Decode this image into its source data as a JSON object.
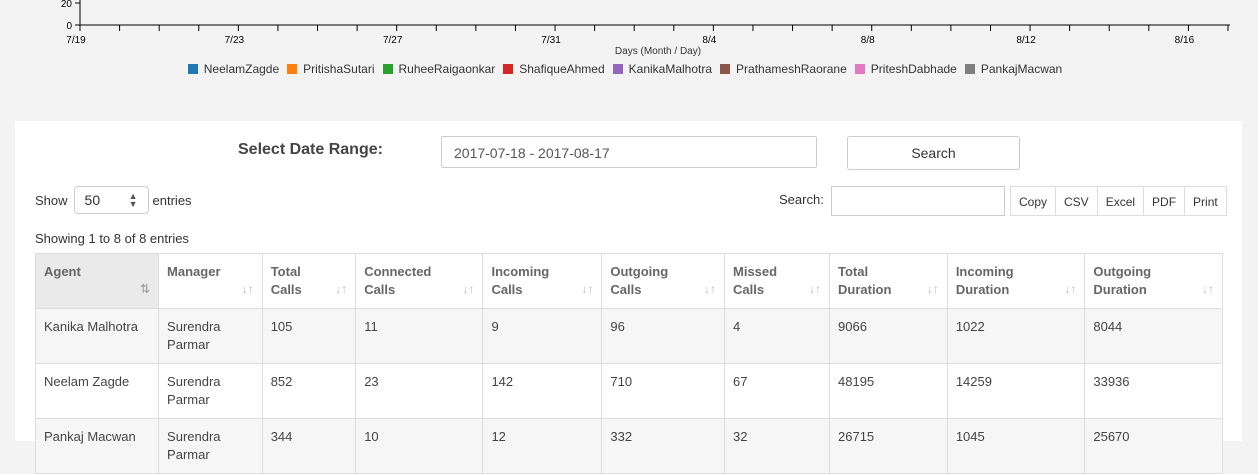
{
  "chart": {
    "y_ticks": [
      "20",
      "0"
    ],
    "x_ticks": [
      "7/19",
      "7/23",
      "7/27",
      "7/31",
      "8/4",
      "8/8",
      "8/12",
      "8/16"
    ],
    "x_label": "Days (Month / Day)",
    "legend": [
      {
        "name": "NeelamZagde",
        "color": "#1f77b4"
      },
      {
        "name": "PritishaSutari",
        "color": "#ff7f0e"
      },
      {
        "name": "RuheeRaigaonkar",
        "color": "#2ca02c"
      },
      {
        "name": "ShafiqueAhmed",
        "color": "#d62728"
      },
      {
        "name": "KanikaMalhotra",
        "color": "#9467bd"
      },
      {
        "name": "PrathameshRaorane",
        "color": "#8c564b"
      },
      {
        "name": "PriteshDabhade",
        "color": "#e377c2"
      },
      {
        "name": "PankajMacwan",
        "color": "#7f7f7f"
      }
    ]
  },
  "filter": {
    "label": "Select Date Range:",
    "date_range": "2017-07-18 - 2017-08-17",
    "search_button": "Search"
  },
  "controls": {
    "show_label": "Show",
    "entries_value": "50",
    "entries_label": "entries",
    "search_label": "Search:",
    "export_buttons": [
      "Copy",
      "CSV",
      "Excel",
      "PDF",
      "Print"
    ],
    "info": "Showing 1 to 8 of 8 entries"
  },
  "table": {
    "headers": [
      [
        "Agent"
      ],
      [
        "Manager"
      ],
      [
        "Total",
        "Calls"
      ],
      [
        "Connected",
        "Calls"
      ],
      [
        "Incoming",
        "Calls"
      ],
      [
        "Outgoing",
        "Calls"
      ],
      [
        "Missed",
        "Calls"
      ],
      [
        "Total",
        "Duration"
      ],
      [
        "Incoming",
        "Duration"
      ],
      [
        "Outgoing",
        "Duration"
      ]
    ],
    "rows": [
      [
        "Kanika Malhotra",
        "Surendra Parmar",
        "105",
        "11",
        "9",
        "96",
        "4",
        "9066",
        "1022",
        "8044"
      ],
      [
        "Neelam Zagde",
        "Surendra Parmar",
        "852",
        "23",
        "142",
        "710",
        "67",
        "48195",
        "14259",
        "33936"
      ],
      [
        "Pankaj Macwan",
        "Surendra Parmar",
        "344",
        "10",
        "12",
        "332",
        "32",
        "26715",
        "1045",
        "25670"
      ]
    ]
  }
}
